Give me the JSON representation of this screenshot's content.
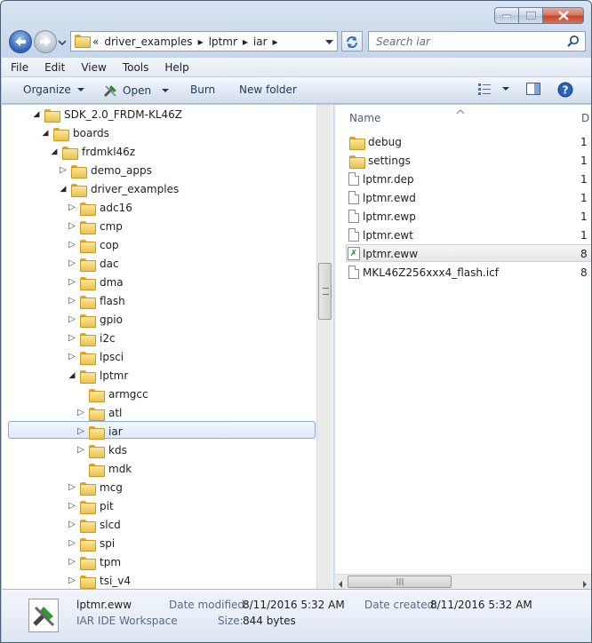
{
  "address": {
    "overflow": "«",
    "segments": [
      "driver_examples",
      "lptmr",
      "iar"
    ]
  },
  "search": {
    "placeholder": "Search iar"
  },
  "menu": [
    "File",
    "Edit",
    "View",
    "Tools",
    "Help"
  ],
  "toolbar": {
    "organize": "Organize",
    "open": "Open",
    "burn": "Burn",
    "new_folder": "New folder"
  },
  "tree": [
    {
      "label": "SDK_2.0_FRDM-KL46Z",
      "depth": 0,
      "state": "open"
    },
    {
      "label": "boards",
      "depth": 1,
      "state": "open"
    },
    {
      "label": "frdmkl46z",
      "depth": 2,
      "state": "open"
    },
    {
      "label": "demo_apps",
      "depth": 3,
      "state": "closed"
    },
    {
      "label": "driver_examples",
      "depth": 3,
      "state": "open"
    },
    {
      "label": "adc16",
      "depth": 4,
      "state": "closed"
    },
    {
      "label": "cmp",
      "depth": 4,
      "state": "closed"
    },
    {
      "label": "cop",
      "depth": 4,
      "state": "closed"
    },
    {
      "label": "dac",
      "depth": 4,
      "state": "closed"
    },
    {
      "label": "dma",
      "depth": 4,
      "state": "closed"
    },
    {
      "label": "flash",
      "depth": 4,
      "state": "closed"
    },
    {
      "label": "gpio",
      "depth": 4,
      "state": "closed"
    },
    {
      "label": "i2c",
      "depth": 4,
      "state": "closed"
    },
    {
      "label": "lpsci",
      "depth": 4,
      "state": "closed"
    },
    {
      "label": "lptmr",
      "depth": 4,
      "state": "open"
    },
    {
      "label": "armgcc",
      "depth": 5,
      "state": "none"
    },
    {
      "label": "atl",
      "depth": 5,
      "state": "closed"
    },
    {
      "label": "iar",
      "depth": 5,
      "state": "closed",
      "selected": true
    },
    {
      "label": "kds",
      "depth": 5,
      "state": "closed"
    },
    {
      "label": "mdk",
      "depth": 5,
      "state": "none"
    },
    {
      "label": "mcg",
      "depth": 4,
      "state": "closed"
    },
    {
      "label": "pit",
      "depth": 4,
      "state": "closed"
    },
    {
      "label": "slcd",
      "depth": 4,
      "state": "closed"
    },
    {
      "label": "spi",
      "depth": 4,
      "state": "closed"
    },
    {
      "label": "tpm",
      "depth": 4,
      "state": "closed"
    },
    {
      "label": "tsi_v4",
      "depth": 4,
      "state": "closed"
    }
  ],
  "columns": {
    "name": "Name",
    "date": "D"
  },
  "files": [
    {
      "name": "debug",
      "type": "folder",
      "date": "1"
    },
    {
      "name": "settings",
      "type": "folder",
      "date": "1"
    },
    {
      "name": "lptmr.dep",
      "type": "file",
      "date": "1"
    },
    {
      "name": "lptmr.ewd",
      "type": "file",
      "date": "1"
    },
    {
      "name": "lptmr.ewp",
      "type": "file",
      "date": "1"
    },
    {
      "name": "lptmr.ewt",
      "type": "file",
      "date": "1"
    },
    {
      "name": "lptmr.eww",
      "type": "eww",
      "date": "8",
      "selected": true
    },
    {
      "name": "MKL46Z256xxx4_flash.icf",
      "type": "file",
      "date": "8"
    }
  ],
  "details": {
    "name": "lptmr.eww",
    "type": "IAR IDE Workspace",
    "modified_label": "Date modified:",
    "modified": "8/11/2016 5:32 AM",
    "size_label": "Size:",
    "size": "844 bytes",
    "created_label": "Date created:",
    "created": "8/11/2016 5:32 AM"
  }
}
